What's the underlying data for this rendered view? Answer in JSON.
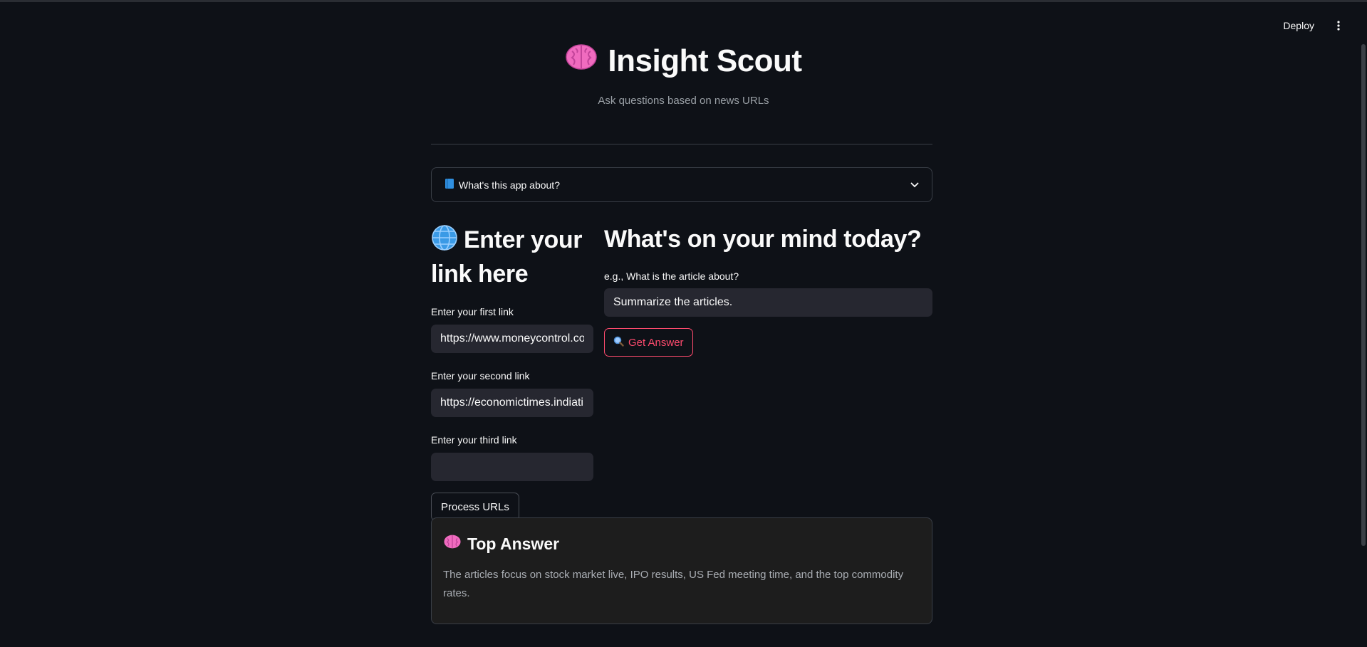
{
  "toolbar": {
    "deploy_label": "Deploy",
    "menu_icon": "kebab-menu-icon"
  },
  "header": {
    "title": "Insight Scout",
    "title_icon": "brain-icon",
    "subtitle": "Ask questions based on news URLs"
  },
  "expander": {
    "icon": "book-icon",
    "label": "What's this app about?",
    "chevron": "chevron-down-icon"
  },
  "links": {
    "heading_icon": "globe-icon",
    "heading": "Enter your link here",
    "fields": [
      {
        "label": "Enter your first link",
        "value": "https://www.moneycontrol.com"
      },
      {
        "label": "Enter your second link",
        "value": "https://economictimes.indiatimes.com"
      },
      {
        "label": "Enter your third link",
        "value": ""
      }
    ],
    "process_label": "Process URLs"
  },
  "question": {
    "heading": "What's on your mind today?",
    "label": "e.g., What is the article about?",
    "value": "Summarize the articles.",
    "button_icon": "magnifier-icon",
    "button_label": "Get Answer"
  },
  "answer": {
    "icon": "brain-icon",
    "title": "Top Answer",
    "text": "The articles focus on stock market live, IPO results, US Fed meeting time, and the top commodity rates."
  },
  "colors": {
    "background": "#0e1117",
    "accent": "#ff4b6e",
    "input": "#262730",
    "card": "#1d1d1d"
  }
}
